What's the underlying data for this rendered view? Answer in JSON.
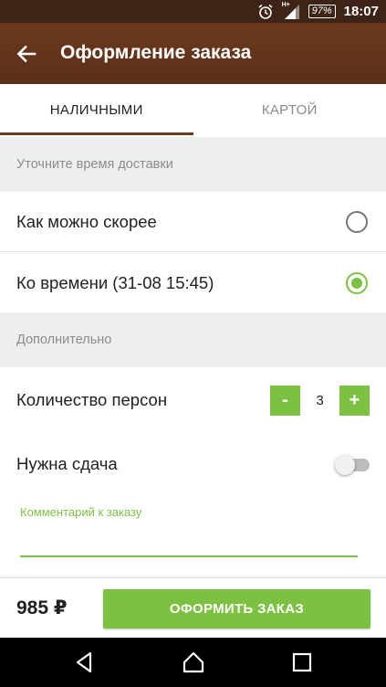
{
  "status_bar": {
    "battery": "97%",
    "time": "18:07",
    "network": "H+",
    "icons": [
      "alarm-icon",
      "signal-icon",
      "battery-icon"
    ]
  },
  "app_bar": {
    "title": "Оформление заказа",
    "back_icon": "arrow-left-icon"
  },
  "tabs": [
    {
      "label": "НАЛИЧНЫМИ",
      "active": true
    },
    {
      "label": "КАРТОЙ",
      "active": false
    }
  ],
  "delivery": {
    "header": "Уточните время доставки",
    "options": [
      {
        "label": "Как можно скорее",
        "selected": false
      },
      {
        "label": "Ко времени (31-08 15:45)",
        "selected": true
      }
    ]
  },
  "extra": {
    "header": "Дополнительно",
    "persons": {
      "label": "Количество персон",
      "minus": "-",
      "plus": "+",
      "value": "3"
    },
    "change": {
      "label": "Нужна сдача",
      "enabled": false
    },
    "comment": {
      "label": "Комментарий к заказу",
      "value": ""
    }
  },
  "footer": {
    "total": "985 ₽",
    "order_button": "ОФОРМИТЬ ЗАКАЗ"
  },
  "colors": {
    "app_bar": "#5a2f18",
    "status_bar": "#3d2416",
    "accent": "#7cc142",
    "tab_indicator": "#6b3a1d",
    "section_bg": "#eeeeee"
  },
  "nav_bar": {
    "icons": [
      "back-triangle-icon",
      "home-icon",
      "recent-apps-icon"
    ]
  }
}
